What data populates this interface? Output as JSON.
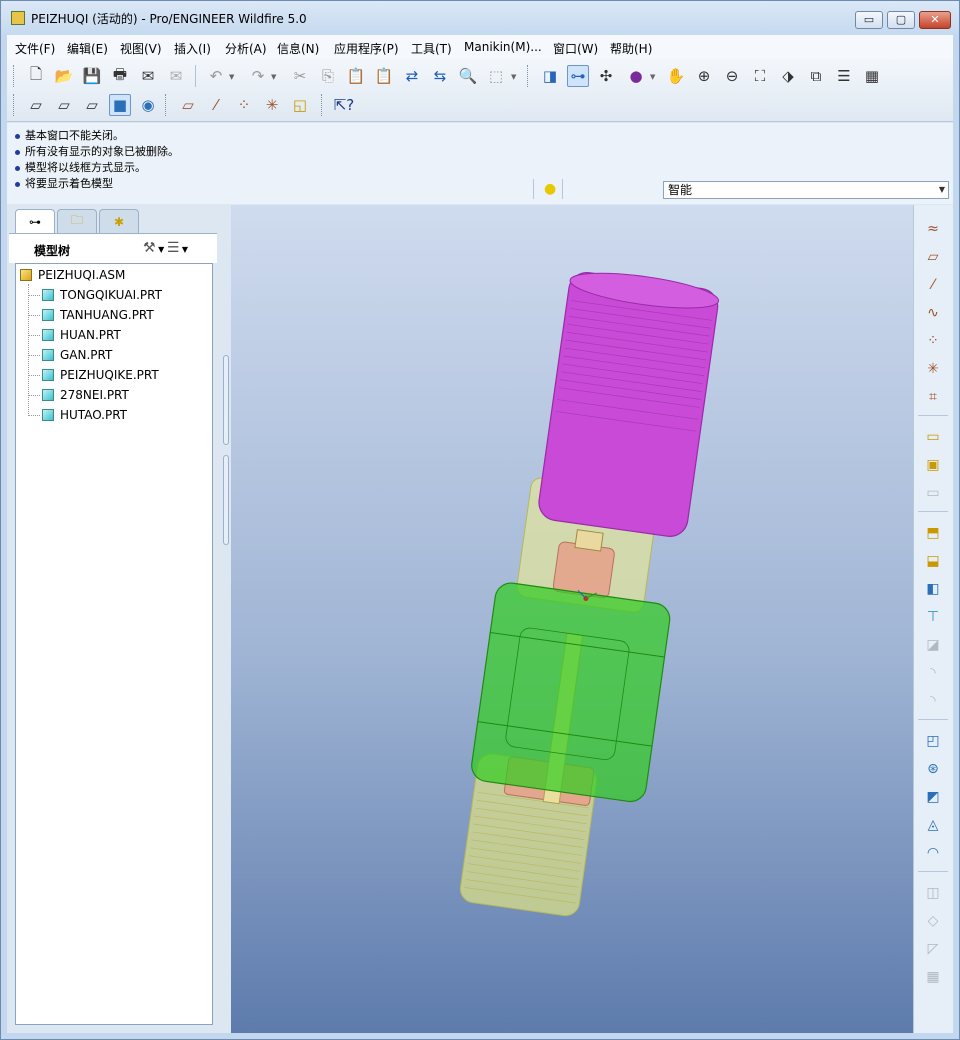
{
  "window": {
    "title": "PEIZHUQI (活动的) - Pro/ENGINEER Wildfire 5.0",
    "minimize": "▭",
    "maximize": "▢",
    "close": "✕"
  },
  "menubar": {
    "items": [
      "文件(F)",
      "编辑(E)",
      "视图(V)",
      "插入(I)",
      "分析(A)",
      "信息(N)",
      "应用程序(P)",
      "工具(T)",
      "Manikin(M)...",
      "窗口(W)",
      "帮助(H)"
    ]
  },
  "toolbar": {
    "row1_icons": [
      "new-file-icon",
      "open-folder-icon",
      "save-icon",
      "print-icon",
      "send-mail-icon",
      "mail-icon",
      "undo-icon",
      "redo-icon",
      "cut-icon",
      "copy-icon",
      "paste-icon",
      "paste-special-icon",
      "regenerate-icon",
      "regen-manager-icon",
      "find-icon",
      "select-box-icon",
      "refit-icon",
      "datum-display-icon",
      "spin-center-icon",
      "appearance-icon",
      "pan-icon",
      "zoom-in-icon",
      "zoom-out-icon",
      "fit-icon",
      "orient-icon",
      "saved-views-icon",
      "layers-icon",
      "view-manager-icon"
    ],
    "row2_icons": [
      "wireframe-icon",
      "hidden-line-icon",
      "no-hidden-icon",
      "shading-icon",
      "enhanced-realism-icon",
      "datum-planes-icon",
      "datum-axes-icon",
      "datum-points-icon",
      "coord-systems-icon",
      "annotations-icon",
      "context-help-icon"
    ]
  },
  "messages": [
    "基本窗口不能关闭。",
    "所有没有显示的对象已被删除。",
    "模型将以线框方式显示。",
    "将要显示着色模型"
  ],
  "filter": {
    "value": "智能"
  },
  "nav_tabs": [
    "model-tree-tab",
    "folder-browser-tab",
    "favorites-tab"
  ],
  "model_tree": {
    "title": "模型树",
    "root": "PEIZHUQI.ASM",
    "items": [
      "TONGQIKUAI.PRT",
      "TANHUANG.PRT",
      "HUAN.PRT",
      "GAN.PRT",
      "PEIZHUQIKE.PRT",
      "278NEI.PRT",
      "HUTAO.PRT"
    ]
  },
  "model_colors": {
    "top_part": "#c84ad6",
    "middle_part": "#33cc22",
    "body_transparent": "#d9dd88",
    "inner_part": "#e6a089",
    "background_top": "#cfdbee",
    "background_bottom": "#5d7bac"
  },
  "right_toolbar_icons": [
    "datum-curve-sketch-icon",
    "datum-plane-icon",
    "datum-axis-icon",
    "datum-curve-icon",
    "datum-point-icon",
    "datum-csys-icon",
    "analysis-feature-icon",
    "place-component-icon",
    "create-component-icon",
    "package-component-icon",
    "extrude-icon",
    "revolve-icon",
    "variable-section-sweep-icon",
    "boundary-blend-icon",
    "style-icon",
    "hole-icon",
    "round-icon",
    "chamfer-icon",
    "draft-icon",
    "shell-icon",
    "rib-icon",
    "pattern-icon",
    "mirror-icon",
    "merge-icon",
    "trim-icon",
    "extend-icon"
  ]
}
